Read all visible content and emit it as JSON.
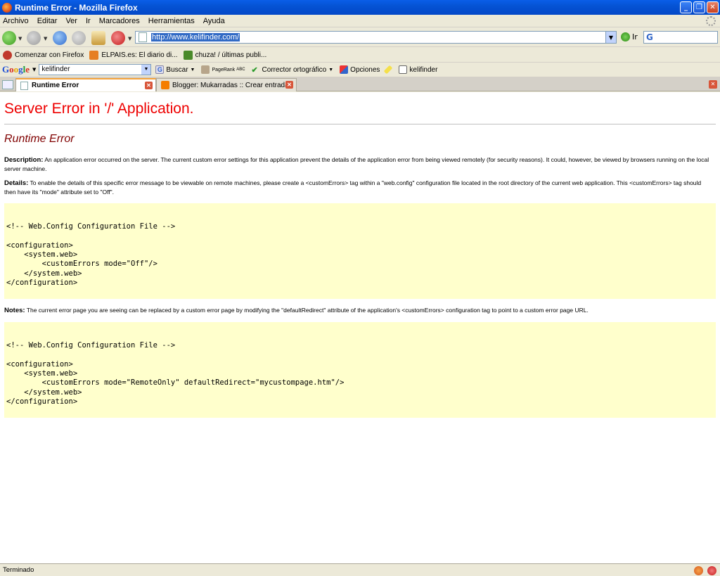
{
  "window": {
    "title": "Runtime Error - Mozilla Firefox"
  },
  "menu": [
    "Archivo",
    "Editar",
    "Ver",
    "Ir",
    "Marcadores",
    "Herramientas",
    "Ayuda"
  ],
  "nav": {
    "url": "http://www.kelifinder.com/",
    "go_label": "Ir"
  },
  "bookmarks": [
    {
      "label": "Comenzar con Firefox",
      "color": "#c0392b"
    },
    {
      "label": "ELPAIS.es: El diario di...",
      "color": "#e67e22"
    },
    {
      "label": "chuza! / últimas publi...",
      "color": "#4a8a2a"
    }
  ],
  "google_toolbar": {
    "logo": [
      "G",
      "o",
      "o",
      "g",
      "l",
      "e"
    ],
    "search_value": "kelifinder",
    "buscar": "Buscar",
    "pagerank": "PageRank",
    "abc": "ABC",
    "corrector": "Corrector ortográfico",
    "opciones": "Opciones",
    "kelifinder": "kelifinder"
  },
  "tabs": [
    {
      "label": "Runtime Error",
      "active": true
    },
    {
      "label": "Blogger: Mukarradas :: Crear entrada",
      "active": false
    }
  ],
  "content": {
    "heading": "Server Error in '/' Application.",
    "subheading": "Runtime Error",
    "description_label": "Description:",
    "description_text": " An application error occurred on the server. The current custom error settings for this application prevent the details of the application error from being viewed remotely (for security reasons). It could, however, be viewed by browsers running on the local server machine.",
    "details_label": "Details:",
    "details_text": " To enable the details of this specific error message to be viewable on remote machines, please create a <customErrors> tag within a \"web.config\" configuration file located in the root directory of the current web application. This <customErrors> tag should then have its \"mode\" attribute set to \"Off\".",
    "code1": "\n\n<!-- Web.Config Configuration File -->\n\n<configuration>\n    <system.web>\n        <customErrors mode=\"Off\"/>\n    </system.web>\n</configuration>\n",
    "notes_label": "Notes:",
    "notes_text": " The current error page you are seeing can be replaced by a custom error page by modifying the \"defaultRedirect\" attribute of the application's <customErrors> configuration tag to point to a custom error page URL.",
    "code2": "\n\n<!-- Web.Config Configuration File -->\n\n<configuration>\n    <system.web>\n        <customErrors mode=\"RemoteOnly\" defaultRedirect=\"mycustompage.htm\"/>\n    </system.web>\n</configuration>\n"
  },
  "status": {
    "text": "Terminado"
  },
  "colors": {
    "heading": "#e00000",
    "subheading": "#800000",
    "codebox": "#ffffcc"
  }
}
